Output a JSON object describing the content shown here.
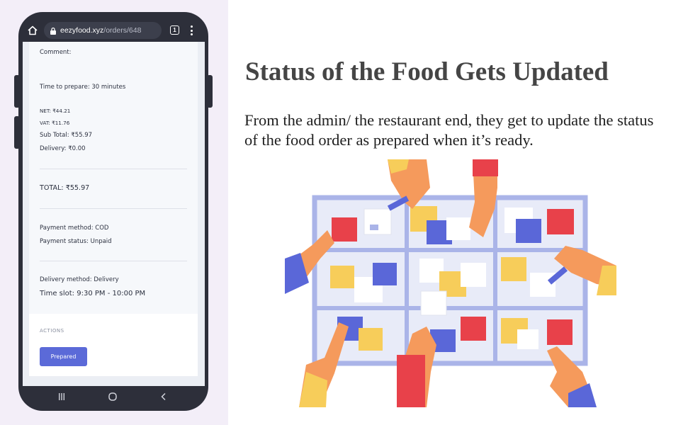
{
  "browser": {
    "url_domain": "eezyfood.xyz",
    "url_path": "/orders/648",
    "tab_count": "1",
    "home_icon": "home-icon",
    "lock_icon": "lock-icon",
    "menu_icon": "more-vert-icon"
  },
  "order": {
    "comment_label": "Comment:",
    "prep_time": "Time to prepare: 30 minutes",
    "net": "NET: ₹44.21",
    "vat": "VAT: ₹11.76",
    "subtotal": "Sub Total: ₹55.97",
    "delivery_fee": "Delivery: ₹0.00",
    "total": "TOTAL: ₹55.97",
    "payment_method": "Payment method: COD",
    "payment_status": "Payment status: Unpaid",
    "delivery_method": "Delivery method: Delivery",
    "time_slot": "Time slot: 9:30 PM - 10:00 PM"
  },
  "actions": {
    "label": "ACTIONS",
    "prepared_button": "Prepared"
  },
  "android_nav": {
    "recents_icon": "recents-icon",
    "home_icon": "circle-home-icon",
    "back_icon": "back-icon"
  },
  "slide": {
    "title": "Status of the Food Gets Updated",
    "description": "From the admin/ the restaurant end, they get to update the status of the food order as prepared when it’s ready."
  },
  "colors": {
    "accent_button": "#5b6ad8",
    "phone_frame": "#2d2f3a",
    "left_panel": "#f3eef8"
  }
}
